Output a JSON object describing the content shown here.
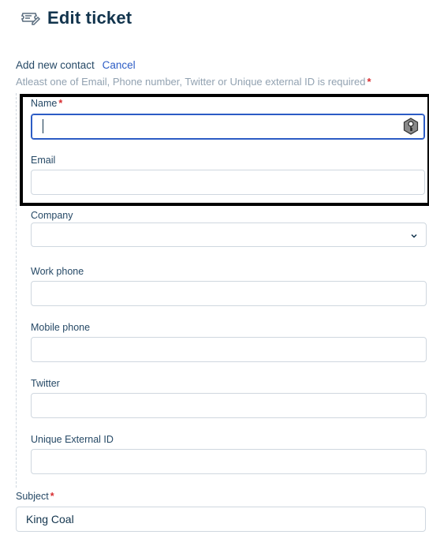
{
  "header": {
    "title": "Edit ticket",
    "icon": "ticket-edit-icon"
  },
  "contact": {
    "add_label": "Add new contact",
    "cancel_label": "Cancel",
    "hint": "Atleast one of Email, Phone number, Twitter or Unique external ID is required",
    "required_mark": "*"
  },
  "fields": {
    "name": {
      "label": "Name",
      "value": "",
      "icon": "password-key-icon"
    },
    "email": {
      "label": "Email",
      "value": ""
    },
    "company": {
      "label": "Company",
      "value": "",
      "icon": "chevron-down-icon"
    },
    "work_phone": {
      "label": "Work phone",
      "value": ""
    },
    "mobile_phone": {
      "label": "Mobile phone",
      "value": ""
    },
    "twitter": {
      "label": "Twitter",
      "value": ""
    },
    "unique_external_id": {
      "label": "Unique External ID",
      "value": ""
    }
  },
  "subject": {
    "label": "Subject",
    "value": "King Coal"
  },
  "colors": {
    "accent": "#2c5cc5",
    "required": "#d72d30",
    "text": "#12344d",
    "border": "#cfd7df"
  }
}
